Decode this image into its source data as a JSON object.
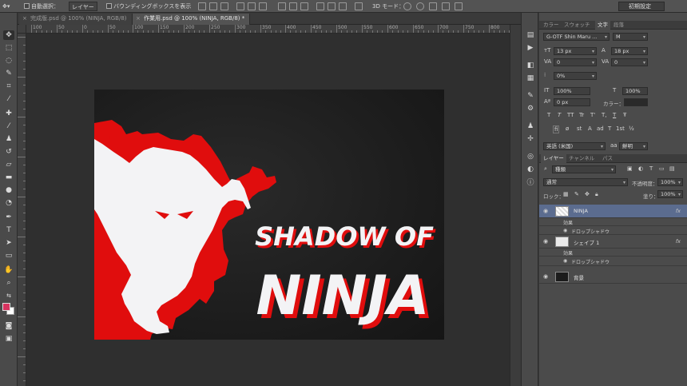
{
  "options_bar": {
    "auto_select_label": "自動選択：",
    "auto_select_value": "レイヤー",
    "bounding_box_label": "バウンディングボックスを表示",
    "mode_3d_label": "3D モード：",
    "preset_label": "初期設定"
  },
  "tabs": [
    {
      "label": "完成版.psd @ 100% (NINJA, RGB/8)",
      "active": false
    },
    {
      "label": "作業用.psd @ 100% (NINJA, RGB/8) *",
      "active": true
    }
  ],
  "ruler": {
    "h_labels": [
      "100",
      "50",
      "0",
      "50",
      "100",
      "150",
      "200",
      "250",
      "300",
      "350",
      "400",
      "450",
      "500",
      "550",
      "600",
      "650",
      "700",
      "750",
      "800"
    ]
  },
  "artwork": {
    "title_line1": "SHADOW OF",
    "title_line2": "NINJA",
    "colors": {
      "shadow": "#e00d0d",
      "figure": "#f3f3f5",
      "background": "#1e1e1e"
    }
  },
  "color_swatches": {
    "foreground": "#d6335f",
    "background": "#ffffff"
  },
  "character_panel": {
    "tabs": [
      "カラー",
      "スウォッチ",
      "文字",
      "段落"
    ],
    "active_tab": "文字",
    "font_family": "G-OTF Shin Maru ...",
    "font_style": "M",
    "font_size": "13 px",
    "leading": "18 px",
    "kerning": "0",
    "tracking": "0",
    "tsume": "0%",
    "vertical_scale": "100%",
    "horizontal_scale": "100%",
    "baseline_shift": "0 px",
    "color_label": "カラー：",
    "style_buttons": [
      "T",
      "T",
      "TT",
      "Tr",
      "T'",
      "T,",
      "T",
      "Ŧ"
    ],
    "opentype_buttons": [
      "fi",
      "ø",
      "st",
      "A",
      "ad",
      "T",
      "1st",
      "½"
    ],
    "language": "英語 (米国)",
    "antialias": "鮮明"
  },
  "layers_panel": {
    "tabs": [
      "レイヤー",
      "チャンネル",
      "パス"
    ],
    "active_tab": "レイヤー",
    "filter_kind": "種類",
    "blend_mode": "通常",
    "opacity_label": "不透明度：",
    "opacity": "100%",
    "lock_label": "ロック：",
    "fill_label": "塗り：",
    "fill": "100%",
    "layers": [
      {
        "name": "NINJA",
        "selected": true,
        "fx": "fx",
        "effects_label": "効果",
        "effects": [
          "ドロップシャドウ"
        ]
      },
      {
        "name": "シェイプ 1",
        "selected": false,
        "fx": "fx",
        "effects_label": "効果",
        "effects": [
          "ドロップシャドウ"
        ]
      },
      {
        "name": "背景",
        "selected": false
      }
    ]
  }
}
